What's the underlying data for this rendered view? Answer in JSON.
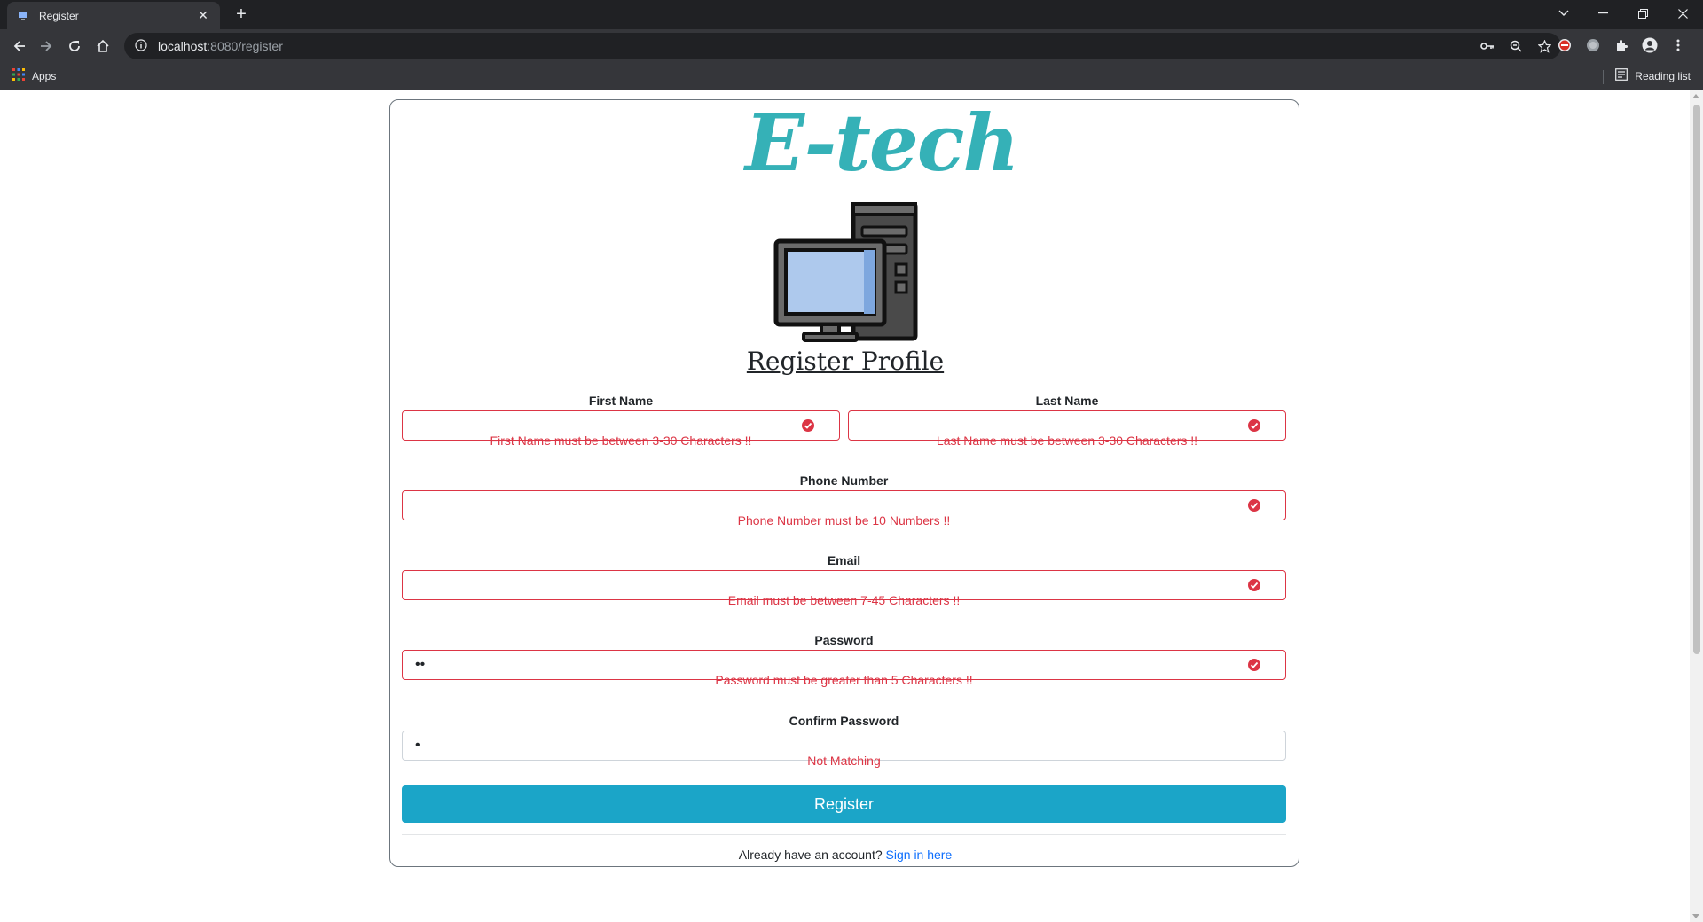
{
  "browser": {
    "tab_title": "Register",
    "new_tab_symbol": "+",
    "url_host": "localhost",
    "url_rest": ":8080/register",
    "bookmarks_apps": "Apps",
    "reading_list": "Reading list"
  },
  "page": {
    "logo_text": "E-tech",
    "title": "Register Profile",
    "fields": {
      "first_name": {
        "label": "First Name",
        "value": "",
        "error": "First Name must be between 3-30 Characters !!"
      },
      "last_name": {
        "label": "Last Name",
        "value": "",
        "error": "Last Name must be between 3-30 Characters !!"
      },
      "phone": {
        "label": "Phone Number",
        "value": "",
        "error": "Phone Number must be 10 Numbers !!"
      },
      "email": {
        "label": "Email",
        "value": "",
        "error": "Email must be between 7-45 Characters !!"
      },
      "password": {
        "label": "Password",
        "value": "••",
        "error": "Password must be greater than 5 Characters !!"
      },
      "confirm_password": {
        "label": "Confirm Password",
        "value": "•",
        "error": "Not Matching"
      }
    },
    "register_button": "Register",
    "footer_text": "Already have an account?",
    "footer_link": "Sign in here"
  },
  "colors": {
    "error": "#dc3545",
    "button": "#1ba5c8",
    "logo": "#35b1b7",
    "link": "#0d6efd"
  },
  "icons": [
    "favicon-icon",
    "close-icon",
    "plus-icon",
    "chevron-down-icon",
    "minimize-icon",
    "restore-icon",
    "window-close-icon",
    "back-arrow-icon",
    "forward-arrow-icon",
    "reload-icon",
    "home-icon",
    "info-icon",
    "key-icon",
    "zoom-icon",
    "star-icon",
    "extension-icon",
    "profile-icon",
    "menu-icon",
    "apps-grid-icon",
    "reading-list-icon",
    "error-circle-icon",
    "desktop-computer-icon"
  ]
}
